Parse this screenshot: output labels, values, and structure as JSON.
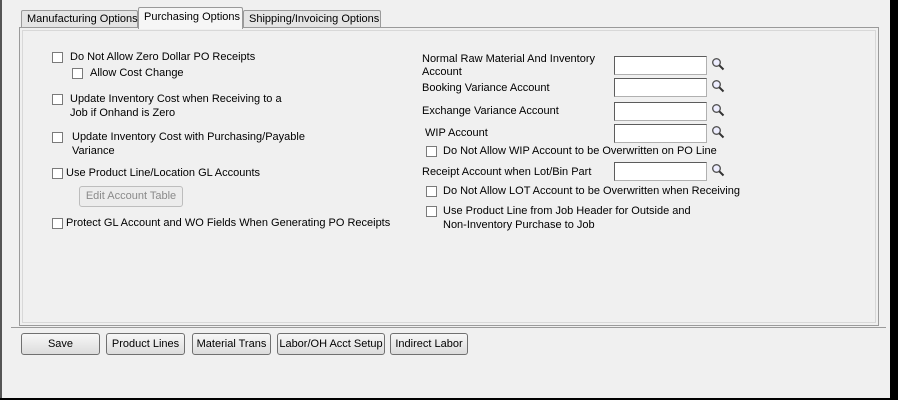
{
  "tabs": [
    {
      "label": "Manufacturing Options"
    },
    {
      "label": "Purchasing Options"
    },
    {
      "label": "Shipping/Invoicing Options"
    }
  ],
  "left_options": {
    "zero_dollar_po": "Do Not Allow Zero Dollar PO Receipts",
    "allow_cost_change": "Allow Cost Change",
    "update_inv_cost_line1": "Update Inventory Cost when Receiving to a",
    "update_inv_cost_line2": "Job if Onhand is Zero",
    "update_inv_variance_line1": "Update Inventory Cost with Purchasing/Payable",
    "update_inv_variance_line2": "Variance",
    "use_product_line": "Use Product Line/Location GL Accounts",
    "edit_account_table": "Edit Account Table",
    "protect_gl": "Protect GL Account and WO Fields When Generating PO Receipts"
  },
  "right_options": {
    "normal_raw_line1": "Normal Raw Material And Inventory",
    "normal_raw_line2": "Account",
    "booking_variance": "Booking Variance Account",
    "exchange_variance": "Exchange Variance Account",
    "wip_account": "WIP Account",
    "no_wip_overwrite": "Do Not Allow WIP Account to be Overwritten on PO Line",
    "receipt_lot_bin": "Receipt Account when Lot/Bin Part",
    "no_lot_overwrite": "Do Not Allow LOT Account to be Overwritten when Receiving",
    "use_job_header_line1": "Use Product Line from Job Header for Outside and",
    "use_job_header_line2": "Non-Inventory Purchase to Job"
  },
  "footer_buttons": {
    "save": "Save",
    "product_lines": "Product Lines",
    "material_trans": "Material Trans",
    "labor_oh": "Labor/OH Acct Setup",
    "indirect_labor": "Indirect Labor"
  },
  "icons": {
    "lookup": "magnifier-icon"
  },
  "colors": {
    "background": "#f0f0f0",
    "border": "#9a9a9a"
  }
}
